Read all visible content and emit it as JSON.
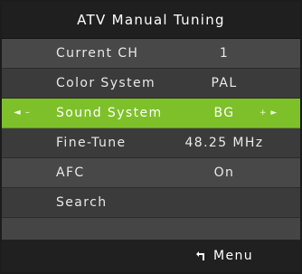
{
  "title": "ATV Manual Tuning",
  "rows": [
    {
      "label": "Current CH",
      "value": "1"
    },
    {
      "label": "Color System",
      "value": "PAL"
    },
    {
      "label": "Sound System",
      "value": "BG",
      "left_indicator": "◄ –",
      "right_indicator": "+ ►"
    },
    {
      "label": "Fine-Tune",
      "value": "48.25 MHz"
    },
    {
      "label": "AFC",
      "value": "On"
    },
    {
      "label": "Search",
      "value": ""
    }
  ],
  "selected_index": 2,
  "footer": {
    "menu_label": "Menu",
    "icon": "return-icon"
  },
  "colors": {
    "highlight": "#7ec02a",
    "title_bar": "#1f1f1f",
    "panel": "#3e3e3e"
  }
}
